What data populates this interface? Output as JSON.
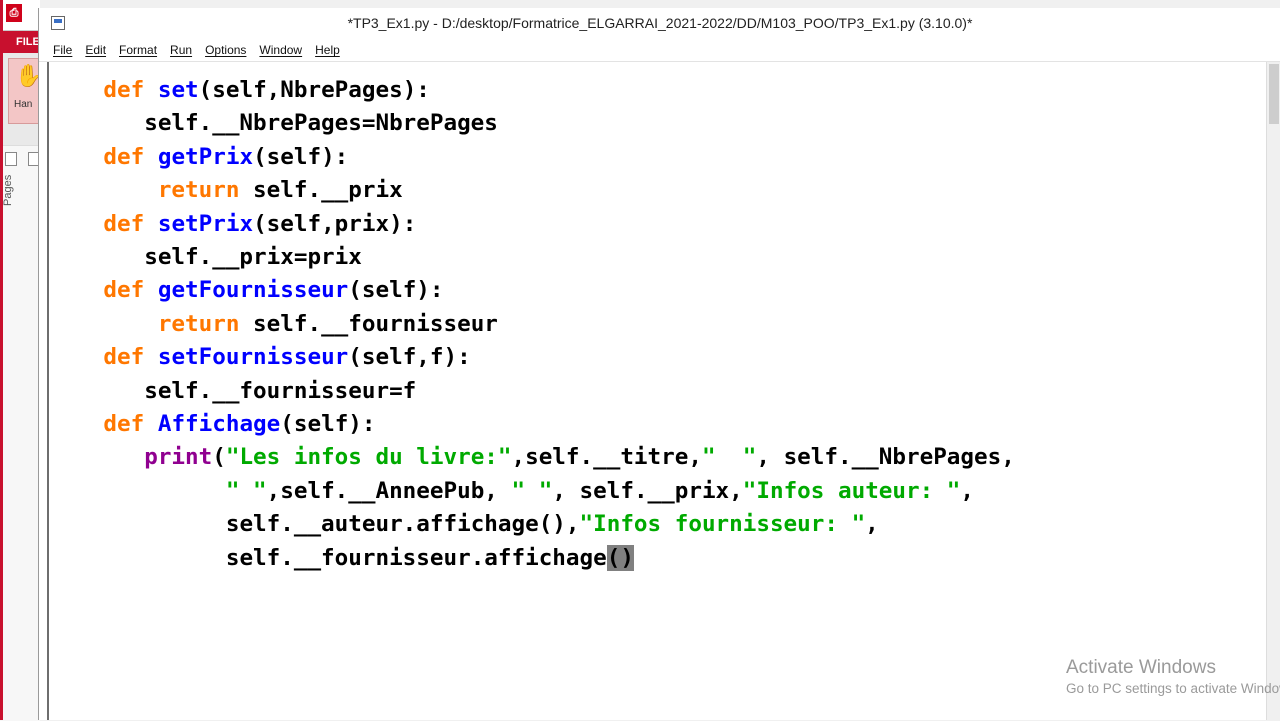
{
  "background_app": {
    "file_tab_label": "FILE",
    "hand_tool_label": "Han",
    "pages_panel_label": "Pages"
  },
  "window": {
    "title": "*TP3_Ex1.py - D:/desktop/Formatrice_ELGARRAI_2021-2022/DD/M103_POO/TP3_Ex1.py (3.10.0)*"
  },
  "menu": {
    "items": [
      "File",
      "Edit",
      "Format",
      "Run",
      "Options",
      "Window",
      "Help"
    ]
  },
  "editor": {
    "lines": [
      {
        "indent": "    ",
        "parts": [
          {
            "t": "def",
            "c": "kw-def"
          },
          {
            "t": " "
          },
          {
            "t": "set",
            "c": "fn"
          },
          {
            "t": "(self,NbrePages):"
          }
        ]
      },
      {
        "indent": "       ",
        "parts": [
          {
            "t": "self.__NbrePages=NbrePages"
          }
        ]
      },
      {
        "indent": "    ",
        "parts": [
          {
            "t": "def",
            "c": "kw-def"
          },
          {
            "t": " "
          },
          {
            "t": "getPrix",
            "c": "fn"
          },
          {
            "t": "(self):"
          }
        ]
      },
      {
        "indent": "        ",
        "parts": [
          {
            "t": "return",
            "c": "kw-ret"
          },
          {
            "t": " self.__prix"
          }
        ]
      },
      {
        "indent": "    ",
        "parts": [
          {
            "t": "def",
            "c": "kw-def"
          },
          {
            "t": " "
          },
          {
            "t": "setPrix",
            "c": "fn"
          },
          {
            "t": "(self,prix):"
          }
        ]
      },
      {
        "indent": "       ",
        "parts": [
          {
            "t": "self.__prix=prix"
          }
        ]
      },
      {
        "indent": "    ",
        "parts": [
          {
            "t": "def",
            "c": "kw-def"
          },
          {
            "t": " "
          },
          {
            "t": "getFournisseur",
            "c": "fn"
          },
          {
            "t": "(self):"
          }
        ]
      },
      {
        "indent": "        ",
        "parts": [
          {
            "t": "return",
            "c": "kw-ret"
          },
          {
            "t": " self.__fournisseur"
          }
        ]
      },
      {
        "indent": "    ",
        "parts": [
          {
            "t": "def",
            "c": "kw-def"
          },
          {
            "t": " "
          },
          {
            "t": "setFournisseur",
            "c": "fn"
          },
          {
            "t": "(self,f):"
          }
        ]
      },
      {
        "indent": "       ",
        "parts": [
          {
            "t": "self.__fournisseur=f"
          }
        ]
      },
      {
        "indent": "    ",
        "parts": [
          {
            "t": "def",
            "c": "kw-def"
          },
          {
            "t": " "
          },
          {
            "t": "Affichage",
            "c": "fn"
          },
          {
            "t": "(self):"
          }
        ]
      },
      {
        "indent": "       ",
        "parts": [
          {
            "t": "print",
            "c": "bi"
          },
          {
            "t": "("
          },
          {
            "t": "\"Les infos du livre:\"",
            "c": "str"
          },
          {
            "t": ",self.__titre,"
          },
          {
            "t": "\"  \"",
            "c": "str"
          },
          {
            "t": ", self.__NbrePages,"
          }
        ]
      },
      {
        "indent": "             ",
        "parts": [
          {
            "t": "\" \"",
            "c": "str"
          },
          {
            "t": ",self.__AnneePub, "
          },
          {
            "t": "\" \"",
            "c": "str"
          },
          {
            "t": ", self.__prix,"
          },
          {
            "t": "\"Infos auteur: \"",
            "c": "str"
          },
          {
            "t": ","
          }
        ]
      },
      {
        "indent": "             ",
        "parts": [
          {
            "t": "self.__auteur.affichage(),"
          },
          {
            "t": "\"Infos fournisseur: \"",
            "c": "str"
          },
          {
            "t": ","
          }
        ]
      },
      {
        "indent": "             ",
        "parts": [
          {
            "t": "self.__fournisseur.affichage"
          },
          {
            "t": "()",
            "c": "hl"
          }
        ]
      }
    ]
  },
  "activation_watermark": {
    "title": "Activate Windows",
    "subtitle": "Go to PC settings to activate Windows."
  }
}
